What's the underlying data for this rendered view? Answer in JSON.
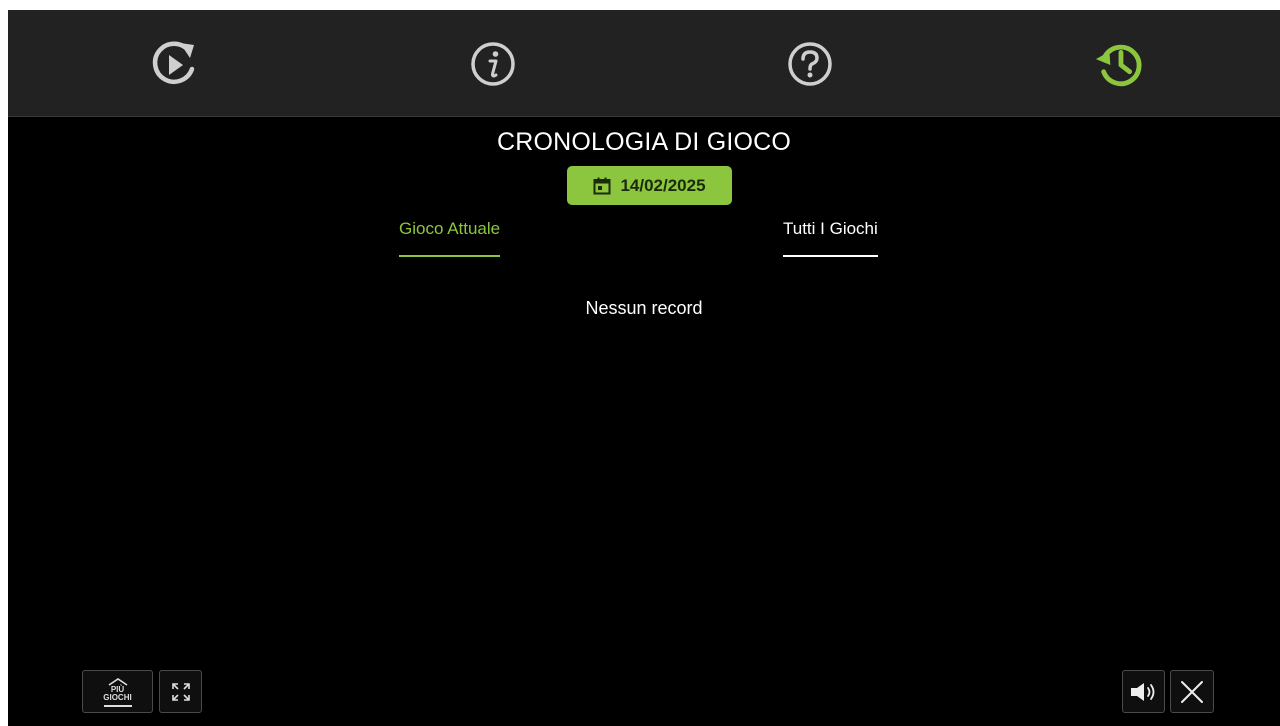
{
  "toolbar": {
    "buttons": [
      {
        "name": "replay",
        "icon": "replay-icon"
      },
      {
        "name": "info",
        "icon": "info-icon"
      },
      {
        "name": "help",
        "icon": "help-icon"
      },
      {
        "name": "history",
        "icon": "history-icon",
        "active": true
      }
    ]
  },
  "history": {
    "title": "CRONOLOGIA DI GIOCO",
    "date": "14/02/2025",
    "date_icon": "calendar-icon",
    "tabs": [
      {
        "label": "Gioco Attuale",
        "active": true
      },
      {
        "label": "Tutti I Giochi",
        "active": false
      }
    ],
    "empty_message": "Nessun record"
  },
  "footer": {
    "more_games_line1": "PIÙ",
    "more_games_line2": "GIOCHI",
    "more_games_icon": "home-icon",
    "fullscreen_icon": "fullscreen-icon",
    "sound_icon": "speaker-icon",
    "close_icon": "close-icon"
  },
  "colors": {
    "accent": "#8cc63f",
    "background": "#000000",
    "topbar": "#222222",
    "icon_gray": "#cfcfcf"
  }
}
